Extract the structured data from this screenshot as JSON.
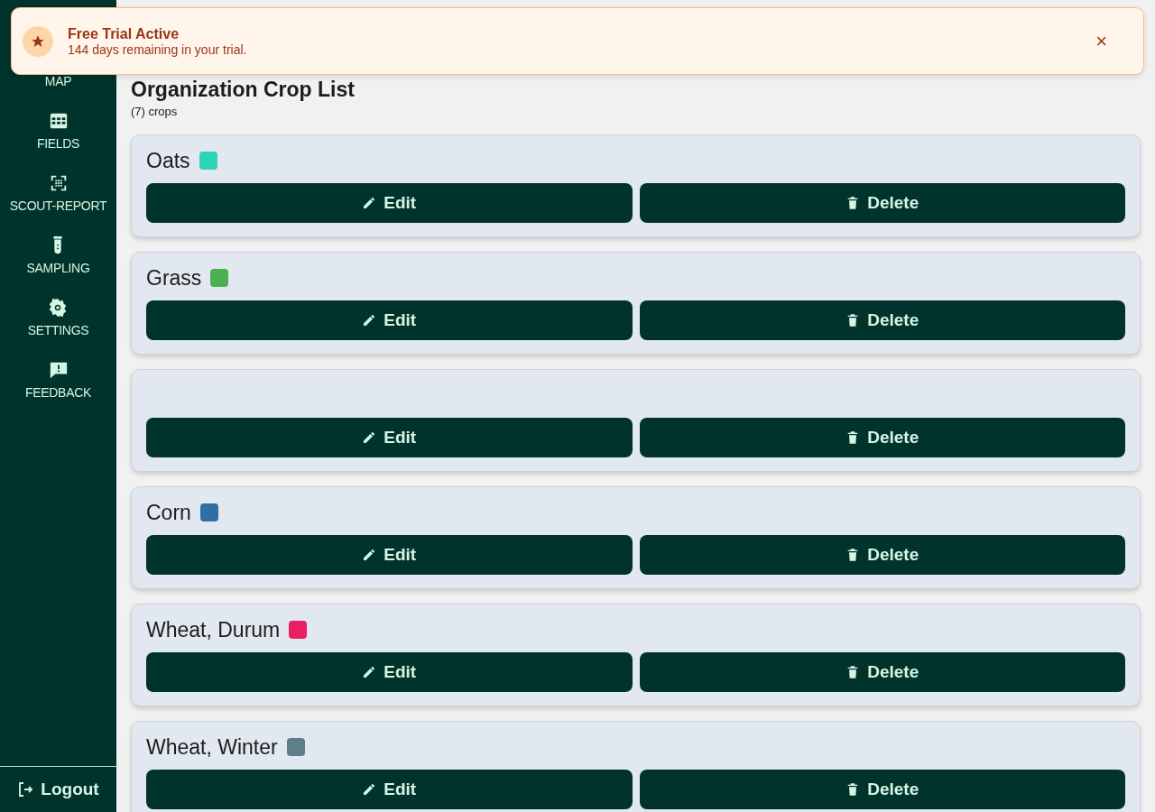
{
  "toast": {
    "title": "Free Trial Active",
    "message": "144 days remaining in your trial.",
    "close": "×"
  },
  "sidebar": {
    "items": [
      {
        "label": "MAP"
      },
      {
        "label": "FIELDS"
      },
      {
        "label": "SCOUT-REPORT"
      },
      {
        "label": "SAMPLING"
      },
      {
        "label": "SETTINGS"
      },
      {
        "label": "FEEDBACK"
      }
    ],
    "logout": "Logout"
  },
  "page": {
    "title": "Organization Crop List",
    "count": "(7) crops"
  },
  "crops": [
    {
      "name": "Oats",
      "color": "#2dd4b4",
      "edit": "Edit",
      "delete": "Delete"
    },
    {
      "name": "Grass",
      "color": "#4caf50",
      "edit": "Edit",
      "delete": "Delete"
    },
    {
      "edit": "Edit",
      "delete": "Delete"
    },
    {
      "name": "Corn",
      "color": "#2f6fa3",
      "edit": "Edit",
      "delete": "Delete"
    },
    {
      "name": "Wheat, Durum",
      "color": "#e91e63",
      "edit": "Edit",
      "delete": "Delete"
    },
    {
      "name": "Wheat, Winter",
      "color": "#607d8b",
      "edit": "Edit",
      "delete": "Delete"
    }
  ]
}
